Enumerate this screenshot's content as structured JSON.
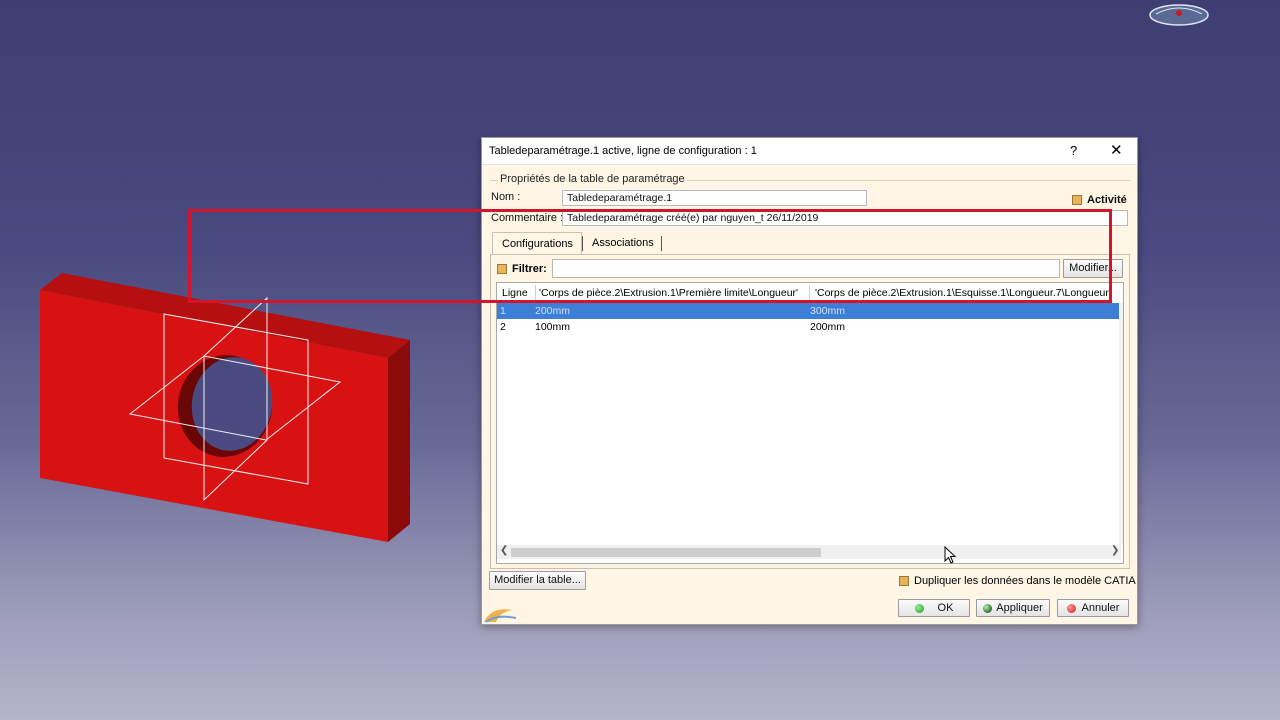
{
  "dialog": {
    "title": "Tabledeparamétrage.1 active, ligne de configuration : 1",
    "help_label": "?",
    "close_label": "✕",
    "group_title": "Propriétés de la table de paramétrage",
    "name_label": "Nom :",
    "name_value": "Tabledeparamétrage.1",
    "activity_label": "Activité",
    "comment_label": "Commentaire :",
    "comment_value": "Tabledeparamétrage créé(e) par nguyen_t 26/11/2019",
    "tabs": [
      {
        "label": "Configurations",
        "active": true
      },
      {
        "label": "Associations",
        "active": false
      }
    ],
    "filter_label": "Filtrer:",
    "filter_value": "",
    "modify_filter_label": "Modifier...",
    "table": {
      "columns": [
        "Ligne",
        "'Corps de pièce.2\\Extrusion.1\\Première limite\\Longueur'",
        "'Corps de pièce.2\\Extrusion.1\\Esquisse.1\\Longueur.7\\Longueur'"
      ],
      "rows": [
        {
          "cells": [
            "1",
            "200mm",
            "300mm"
          ],
          "selected": true
        },
        {
          "cells": [
            "2",
            "100mm",
            "200mm"
          ],
          "selected": false
        }
      ]
    },
    "modify_table_label": "Modifier la table...",
    "duplicate_label": "Dupliquer les données dans le modèle CATIA",
    "ok_label": "OK",
    "apply_label": "Appliquer",
    "cancel_label": "Annuler"
  },
  "colors": {
    "part_red": "#d81212",
    "highlight_red": "#d4142a",
    "selection_blue": "#3d7fd6",
    "dialog_bg": "#fff6e6"
  }
}
